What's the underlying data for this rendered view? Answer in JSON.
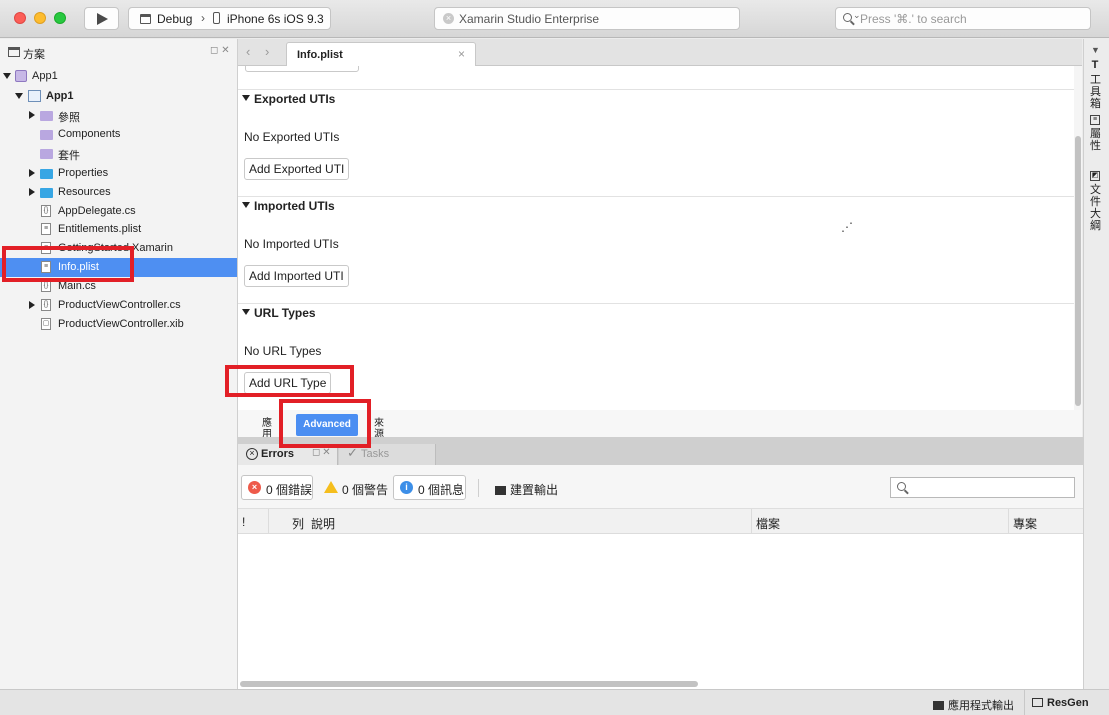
{
  "toolbar": {
    "config": "Debug",
    "device": "iPhone 6s iOS 9.3",
    "status": "Xamarin Studio Enterprise",
    "search_placeholder": "Press '⌘.' to search"
  },
  "solution_pad": {
    "title": "方案",
    "items": [
      {
        "label": "App1"
      },
      {
        "label": "App1"
      },
      {
        "label": "參照"
      },
      {
        "label": "Components"
      },
      {
        "label": "套件"
      },
      {
        "label": "Properties"
      },
      {
        "label": "Resources"
      },
      {
        "label": "AppDelegate.cs"
      },
      {
        "label": "Entitlements.plist"
      },
      {
        "label": "GettingStarted.Xamarin"
      },
      {
        "label": "Info.plist"
      },
      {
        "label": "Main.cs"
      },
      {
        "label": "ProductViewController.cs"
      },
      {
        "label": "ProductViewController.xib"
      }
    ]
  },
  "editor": {
    "tab_title": "Info.plist",
    "sections": [
      {
        "title": "Exported UTIs",
        "empty_text": "No Exported UTIs",
        "button": "Add Exported UTI"
      },
      {
        "title": "Imported UTIs",
        "empty_text": "No Imported UTIs",
        "button": "Add Imported UTI"
      },
      {
        "title": "URL Types",
        "empty_text": "No URL Types",
        "button": "Add URL Type"
      }
    ],
    "bottom_tabs": {
      "left_vertical": "應用",
      "advanced": "Advanced",
      "right_vertical": "來源"
    }
  },
  "errors_pad": {
    "tab_errors": "Errors",
    "tab_tasks": "Tasks",
    "errors_count": "0 個錯誤",
    "warnings_count": "0 個警告",
    "messages_count": "0 個訊息",
    "build_output": "建置輸出",
    "columns": {
      "bang": "!",
      "line": "列",
      "description": "說明",
      "file": "檔案",
      "project": "專案"
    }
  },
  "right_pads": [
    {
      "label": "工具箱"
    },
    {
      "label": "屬性"
    },
    {
      "label": "文件大綱"
    }
  ],
  "statusbar": {
    "app_output": "應用程式輸出",
    "resgen": "ResGen"
  },
  "colors": {
    "selection": "#4e8ff2",
    "highlight": "#e21f26",
    "advanced_button": "#4b8ef2"
  }
}
